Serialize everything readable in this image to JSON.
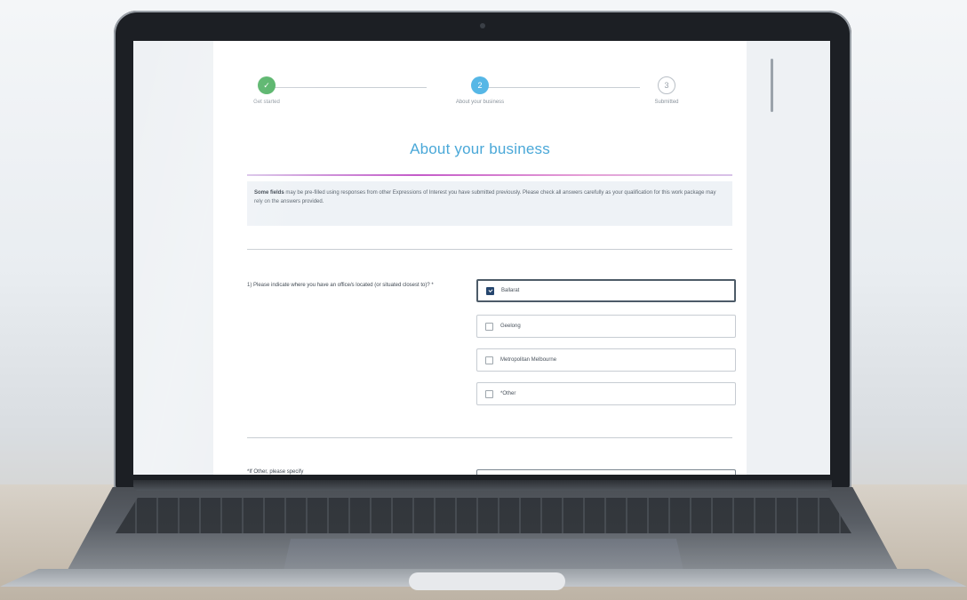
{
  "stepper": {
    "steps": [
      {
        "label": "Get started",
        "status": "done",
        "number": ""
      },
      {
        "label": "About your business",
        "status": "active",
        "number": "2"
      },
      {
        "label": "Submitted",
        "status": "pending",
        "number": "3"
      }
    ]
  },
  "form": {
    "title": "About your business",
    "info_lead": "Some fields",
    "info_text": " may be pre-filled using responses from other Expressions of Interest you have submitted previously. Please check all answers carefully as your qualification for this work package may rely on the answers provided.",
    "question1": {
      "label": "1) Please indicate where you have an office/s located (or situated closest to)? *",
      "options": [
        {
          "label": "Ballarat",
          "checked": true
        },
        {
          "label": "Geelong",
          "checked": false
        },
        {
          "label": "Metropolitan Melbourne",
          "checked": false
        },
        {
          "label": "*Other",
          "checked": false
        }
      ]
    },
    "question2": {
      "label": "*If Other, please specify",
      "value": ""
    }
  },
  "colors": {
    "accent": "#4aa8d8",
    "step_done": "#4caf60",
    "step_active": "#56b7e6",
    "checkbox_checked": "#26466e",
    "rule_gradient_mid": "#c45bc9"
  }
}
